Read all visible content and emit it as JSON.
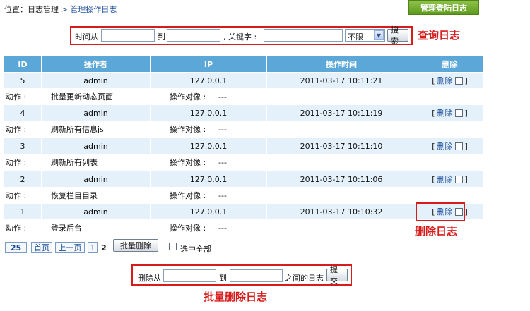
{
  "breadcrumb": {
    "prefix": "位置：",
    "item1": "日志管理",
    "sep": ">",
    "item2": "管理操作日志"
  },
  "top_button": "管理登陆日志",
  "search": {
    "from_label": "时间从",
    "to_label": "到",
    "keyword_label": ", 关键字 :",
    "select_value": "不限",
    "submit": "搜索",
    "annotation": "查询日志"
  },
  "table": {
    "headers": [
      "ID",
      "操作者",
      "IP",
      "操作时间",
      "删除"
    ],
    "action_label": "动作 :",
    "target_label": "操作对像 :",
    "rows": [
      {
        "id": "5",
        "user": "admin",
        "ip": "127.0.0.1",
        "time": "2011-03-17 10:11:21",
        "action": "批量更新动态页面",
        "target": "---"
      },
      {
        "id": "4",
        "user": "admin",
        "ip": "127.0.0.1",
        "time": "2011-03-17 10:11:19",
        "action": "刷新所有信息js",
        "target": "---"
      },
      {
        "id": "3",
        "user": "admin",
        "ip": "127.0.0.1",
        "time": "2011-03-17 10:11:10",
        "action": "刷新所有列表",
        "target": "---"
      },
      {
        "id": "2",
        "user": "admin",
        "ip": "127.0.0.1",
        "time": "2011-03-17 10:11:06",
        "action": "恢复栏目目录",
        "target": "---"
      },
      {
        "id": "1",
        "user": "admin",
        "ip": "127.0.0.1",
        "time": "2011-03-17 10:10:32",
        "action": "登录后台",
        "target": "---"
      }
    ],
    "delete_open": "[",
    "delete_link": "删除",
    "delete_close": "]",
    "delete_annotation": "删除日志"
  },
  "pager": {
    "total": "25",
    "first": "首页",
    "prev": "上一页",
    "page1": "1",
    "page2": "2",
    "batch_delete": "批量删除",
    "select_all": "选中全部"
  },
  "bulk_delete": {
    "from_label": "删除从",
    "to_label": "到",
    "between_label": "之间的日志",
    "submit": "提交",
    "annotation": "批量删除日志"
  },
  "colors": {
    "header_bg": "#5aa7d8",
    "row_bg": "#e4f1fb",
    "annotation": "#d61c1c",
    "top_button": "#6aa82a",
    "link": "#1f4f9a"
  }
}
